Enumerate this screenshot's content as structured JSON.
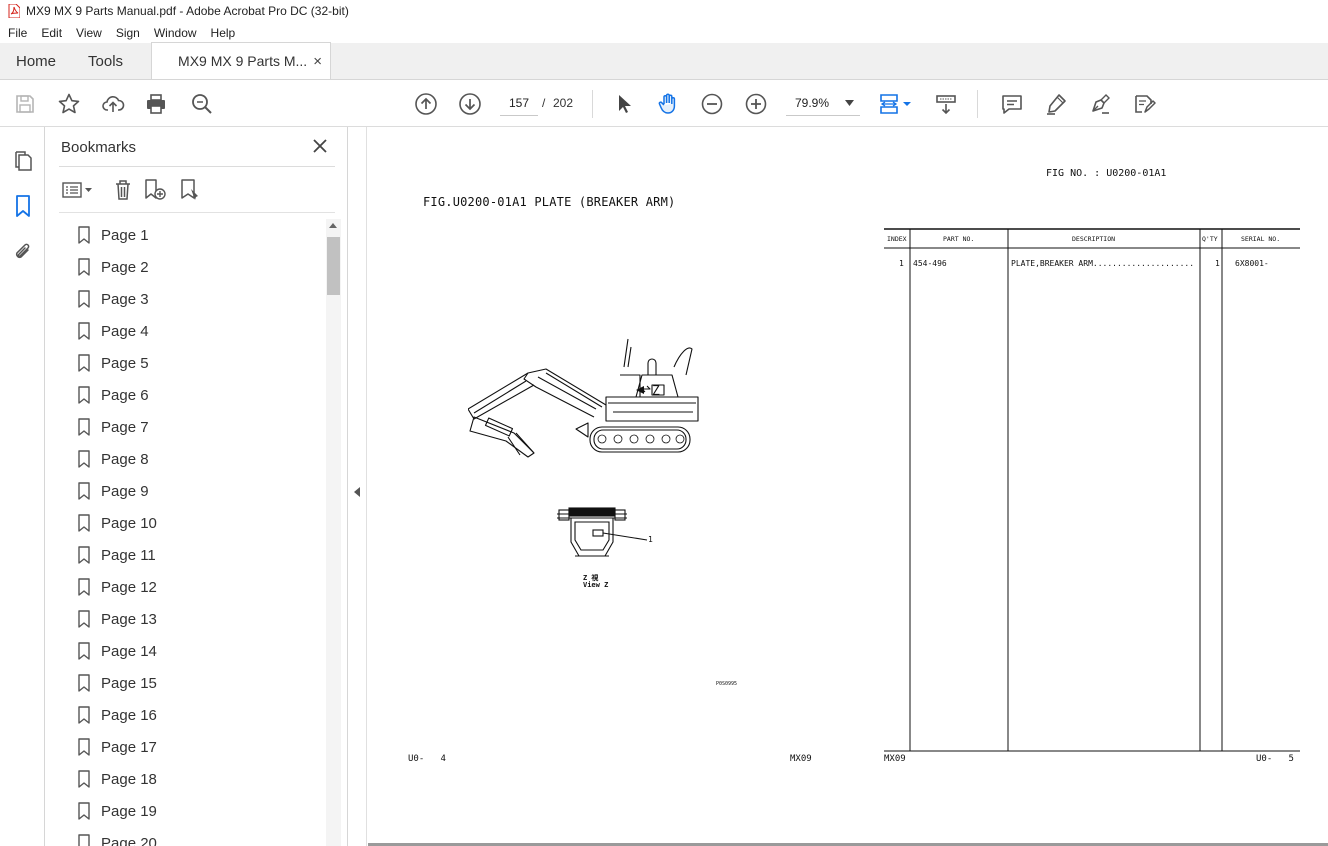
{
  "window": {
    "title": "MX9 MX 9 Parts Manual.pdf - Adobe Acrobat Pro DC (32-bit)"
  },
  "menu": [
    "File",
    "Edit",
    "View",
    "Sign",
    "Window",
    "Help"
  ],
  "tabs": {
    "home": "Home",
    "tools": "Tools",
    "document": "MX9 MX 9 Parts M...",
    "close": "×"
  },
  "toolbar": {
    "current_page": "157",
    "separator": "/",
    "total_pages": "202",
    "zoom": "79.9%"
  },
  "bookmarks": {
    "title": "Bookmarks",
    "items": [
      "Page 1",
      "Page 2",
      "Page 3",
      "Page 4",
      "Page 5",
      "Page 6",
      "Page 7",
      "Page 8",
      "Page 9",
      "Page 10",
      "Page 11",
      "Page 12",
      "Page 13",
      "Page 14",
      "Page 15",
      "Page 16",
      "Page 17",
      "Page 18",
      "Page 19",
      "Page 20"
    ]
  },
  "document": {
    "left_page": {
      "fig_title": "FIG.U0200-01A1  PLATE (BREAKER ARM)",
      "view_label_1": "Z  視",
      "view_label_2": "View Z",
      "callout": "1",
      "drawing_code": "P0S0995",
      "footer_left": "U0-   4",
      "footer_right": "MX09"
    },
    "right_page": {
      "fig_no": "FIG NO. : U0200-01A1",
      "columns": [
        "INDEX",
        "PART NO.",
        "DESCRIPTION",
        "Q'TY",
        "SERIAL NO."
      ],
      "rows": [
        {
          "index": "1",
          "part_no": "454-496",
          "description": "PLATE,BREAKER ARM.....................",
          "qty": "1",
          "serial": "6X8001-"
        }
      ],
      "footer_left": "MX09",
      "footer_right": "U0-   5"
    }
  }
}
